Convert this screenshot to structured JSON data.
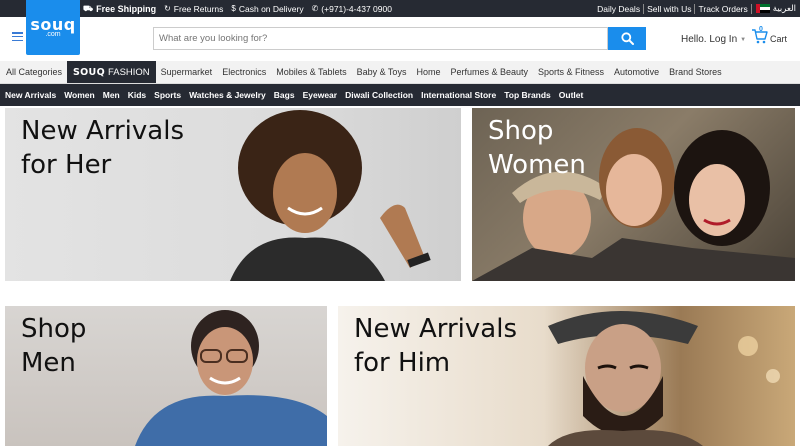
{
  "topbar": {
    "free_shipping": "Free Shipping",
    "free_returns": "Free Returns",
    "cash_on_delivery": "Cash on Delivery",
    "phone": "(+971)-4-437 0900",
    "daily_deals": "Daily Deals",
    "sell_with_us": "Sell with Us",
    "track_orders": "Track Orders",
    "language": "العربية"
  },
  "logo": {
    "word": "souq",
    "suffix": ".com"
  },
  "header": {
    "search_placeholder": "What are you looking for?",
    "account_label": "Hello. Log In",
    "cart_label": "Cart",
    "cart_count": "0"
  },
  "category_nav": {
    "items": [
      "All Categories",
      "Supermarket",
      "Electronics",
      "Mobiles & Tablets",
      "Baby & Toys",
      "Home",
      "Perfumes & Beauty",
      "Sports & Fitness",
      "Automotive",
      "Brand Stores"
    ],
    "fashion_brand": "SOUQ",
    "fashion_label": "FASHION"
  },
  "sub_nav": {
    "items": [
      "New Arrivals",
      "Women",
      "Men",
      "Kids",
      "Sports",
      "Watches & Jewelry",
      "Bags",
      "Eyewear",
      "Diwali Collection",
      "International Store",
      "Top Brands",
      "Outlet"
    ]
  },
  "banners": [
    {
      "title": "New Arrivals\nfor Her"
    },
    {
      "title": "Shop\nWomen"
    },
    {
      "title": "Shop\nMen"
    },
    {
      "title": "New Arrivals\nfor Him"
    }
  ],
  "colors": {
    "brand_blue": "#1a8dec",
    "dark_bar": "#262a33"
  }
}
